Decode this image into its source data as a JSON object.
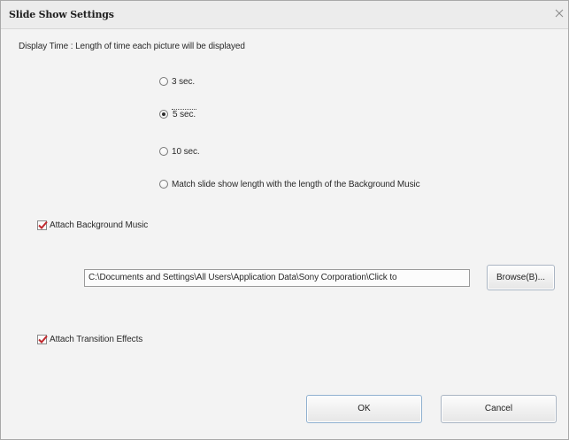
{
  "window": {
    "title": "Slide Show Settings",
    "close_icon": "close-icon"
  },
  "display_time": {
    "description": "Display Time : Length of time each picture will be displayed",
    "options": [
      {
        "label": "3 sec.",
        "selected": false
      },
      {
        "label": "5 sec.",
        "selected": true
      },
      {
        "label": "10 sec.",
        "selected": false
      },
      {
        "label": "Match slide show length with the length of the Background Music",
        "selected": false
      }
    ]
  },
  "background_music": {
    "label": "Attach Background Music",
    "checked": true,
    "path": "C:\\Documents and Settings\\All Users\\Application Data\\Sony Corporation\\Click to",
    "browse_label": "Browse(B)..."
  },
  "transition_effects": {
    "label": "Attach Transition Effects",
    "checked": true
  },
  "buttons": {
    "ok_label": "OK",
    "cancel_label": "Cancel"
  },
  "colors": {
    "check_mark": "#c0282d",
    "background": "#f3f3f3"
  }
}
